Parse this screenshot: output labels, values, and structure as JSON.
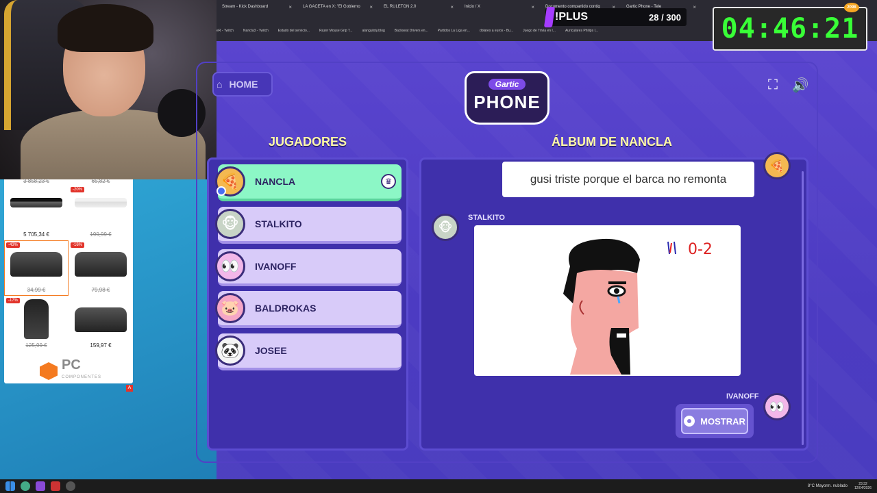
{
  "browser": {
    "tabs": [
      {
        "label": "Stream - Kick Dashboard"
      },
      {
        "label": "LA GACETA en X: \"El Gobierno"
      },
      {
        "label": "EL RULETON 2.0"
      },
      {
        "label": "Inicio / X"
      },
      {
        "label": "Documento compartido contig"
      },
      {
        "label": "Gartic Phone - Tele"
      }
    ],
    "bookmarks": [
      "eR - Twitch",
      "Nancla3 - Twitch",
      "Estado del servicio...",
      "Razer Mouse Grip T...",
      "alanguloty.blog",
      "Backseat Drivers en...",
      "Partidos La Liga en...",
      "dolares a euros - Bu...",
      "Juego de Trivia en I...",
      "Auriculares Philips I..."
    ]
  },
  "overlay": {
    "plus_label": "!PLUS",
    "plus_count": "28 / 300",
    "timer": "04:46:21",
    "timer_badge": "2098"
  },
  "shop": {
    "prices": [
      "5 705,34 €",
      "199,99 €",
      "34,99 €",
      "79,98 €",
      "125,99 €",
      "159,97 €"
    ],
    "top_prices": [
      "3 858,23 €",
      "65,82 €"
    ],
    "badges": [
      "-20%",
      "-43%",
      "-16%",
      "-17%"
    ],
    "logo": "PC",
    "logo_sub": "COMPONENTES",
    "ad_marker": "A"
  },
  "game": {
    "home_label": "HOME",
    "logo_top": "Gartic",
    "logo_bottom": "PHONE",
    "players_title": "JUGADORES",
    "album_title": "ÁLBUM DE NANCLA",
    "players": [
      {
        "name": "NANCLA"
      },
      {
        "name": "STALKITO"
      },
      {
        "name": "IVANOFF"
      },
      {
        "name": "BALDROKAS"
      },
      {
        "name": "JOSEE"
      }
    ],
    "prompt_text": "gusi triste porque el barca no remonta",
    "drawing_author": "STALKITO",
    "next_author": "IVANOFF",
    "drawing_score": "0-2",
    "show_button": "MOSTRAR"
  },
  "taskbar": {
    "weather": "8°C  Mayorm. nublado",
    "time": "23:32",
    "date": "12/04/2026"
  },
  "icons": {
    "home": "home-icon",
    "fullscreen": "fullscreen-icon",
    "volume": "volume-icon",
    "crown": "crown-icon",
    "eye": "eye-icon"
  }
}
